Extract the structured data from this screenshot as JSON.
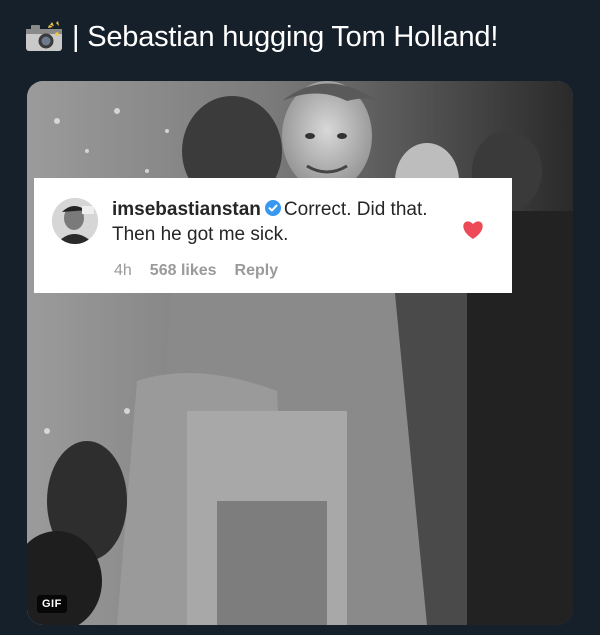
{
  "tweet": {
    "icon": "camera-icon",
    "text": "| Sebastian hugging Tom Holland!"
  },
  "media": {
    "badge": "GIF"
  },
  "comment": {
    "username": "imsebastianstan",
    "verified": true,
    "text": "Correct. Did that. Then he got me sick.",
    "time": "4h",
    "likes": "568 likes",
    "reply": "Reply",
    "liked": true,
    "heart_color": "#ed4956"
  },
  "colors": {
    "background": "#15202b",
    "verified_blue": "#3897f0"
  }
}
